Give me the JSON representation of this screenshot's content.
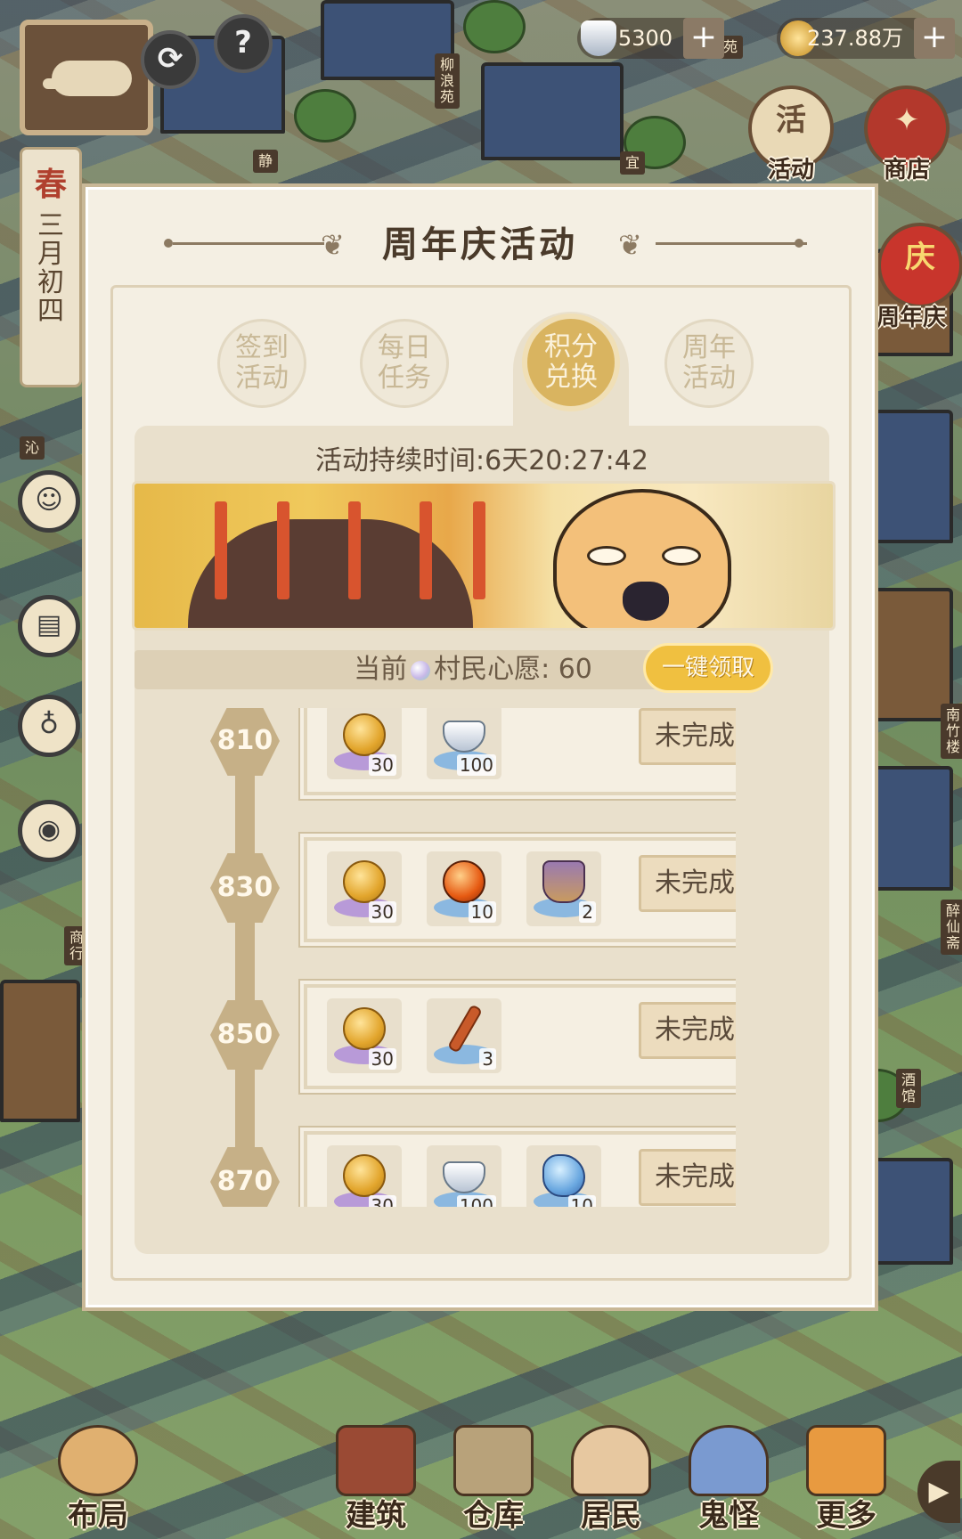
{
  "hud": {
    "season": "春",
    "date": "三月初四",
    "silver_amount": "5300",
    "coin_amount": "237.88万",
    "plus": "+",
    "help": "?",
    "activity_label": "活动",
    "shop_label": "商店",
    "anniversary_label": "周年庆",
    "activity_glyph": "活",
    "anniversary_glyph": "庆"
  },
  "map_signs": [
    "柳浪苑",
    "静",
    "宜",
    "沁",
    "南竹楼",
    "醉仙斋",
    "酒馆",
    "苑",
    "商行"
  ],
  "dialog": {
    "title": "周年庆活动",
    "tabs": [
      {
        "label": "签到活动",
        "active": false
      },
      {
        "label": "每日任务",
        "active": false
      },
      {
        "label": "积分兑换",
        "active": true
      },
      {
        "label": "周年活动",
        "active": false
      }
    ],
    "timer": "活动持续时间:6天20:27:42",
    "wish": {
      "prefix": "当前",
      "label": "村民心愿: 60"
    },
    "claim_all": "一键领取",
    "rewards": [
      {
        "threshold": "810",
        "status": "未完成",
        "items": [
          {
            "icon": "coin-icon",
            "qty": "30"
          },
          {
            "icon": "silver-ingot-icon",
            "qty": "100"
          }
        ]
      },
      {
        "threshold": "830",
        "status": "未完成",
        "items": [
          {
            "icon": "coin-icon",
            "qty": "30"
          },
          {
            "icon": "fire-orb-icon",
            "qty": "10"
          },
          {
            "icon": "bell-icon",
            "qty": "2"
          }
        ]
      },
      {
        "threshold": "850",
        "status": "未完成",
        "items": [
          {
            "icon": "coin-icon",
            "qty": "30"
          },
          {
            "icon": "firecracker-icon",
            "qty": "3"
          }
        ]
      },
      {
        "threshold": "870",
        "status": "未完成",
        "items": [
          {
            "icon": "coin-icon",
            "qty": "30"
          },
          {
            "icon": "silver-ingot-icon",
            "qty": "100"
          },
          {
            "icon": "water-spirit-icon",
            "qty": "10"
          }
        ]
      }
    ]
  },
  "bottom_nav": [
    "布局",
    "建筑",
    "仓库",
    "居民",
    "鬼怪",
    "更多"
  ],
  "colors": {
    "accent_gold": "#d9b460",
    "panel": "#f4efe3",
    "track": "#c6b087"
  }
}
